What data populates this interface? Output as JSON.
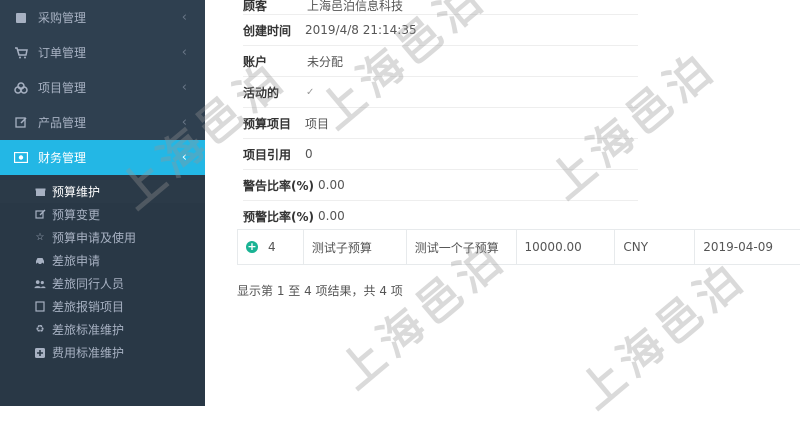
{
  "sidebar": {
    "items": [
      {
        "label": "采购管理",
        "icon": "book-icon"
      },
      {
        "label": "订单管理",
        "icon": "cart-icon"
      },
      {
        "label": "项目管理",
        "icon": "cubes-icon"
      },
      {
        "label": "产品管理",
        "icon": "edit-icon"
      },
      {
        "label": "财务管理",
        "icon": "money-icon",
        "active": true
      }
    ],
    "subitems": [
      {
        "label": "预算维护",
        "icon": "gift-icon",
        "active": true
      },
      {
        "label": "预算变更",
        "icon": "edit-icon"
      },
      {
        "label": "预算申请及使用",
        "icon": "star-icon"
      },
      {
        "label": "差旅申请",
        "icon": "car-icon"
      },
      {
        "label": "差旅同行人员",
        "icon": "users-icon"
      },
      {
        "label": "差旅报销项目",
        "icon": "file-icon"
      },
      {
        "label": "差旅标准维护",
        "icon": "recycle-icon"
      },
      {
        "label": "费用标准维护",
        "icon": "plus-square-icon"
      }
    ]
  },
  "detail": {
    "customer_label": "顾客",
    "customer_value": "上海邑泊信息科技",
    "created_label": "创建时间",
    "created_value": "2019/4/8 21:14:35",
    "account_label": "账户",
    "account_value": "未分配",
    "active_label": "活动的",
    "active_value": "✓",
    "budget_item_label": "预算项目",
    "budget_item_value": "项目",
    "project_ref_label": "项目引用",
    "project_ref_value": "0",
    "warn_ratio_label": "警告比率(%)",
    "warn_ratio_value": "0.00",
    "alert_ratio_label": "预警比率(%)",
    "alert_ratio_value": "0.00"
  },
  "table_row": {
    "no": "4",
    "name": "测试子预算",
    "description": "测试一个子预算",
    "amount": "10000.00",
    "currency": "CNY",
    "date": "2019-04-09"
  },
  "summary": "显示第 1 至 4 项结果，共 4 项",
  "watermark": "上海邑泊"
}
